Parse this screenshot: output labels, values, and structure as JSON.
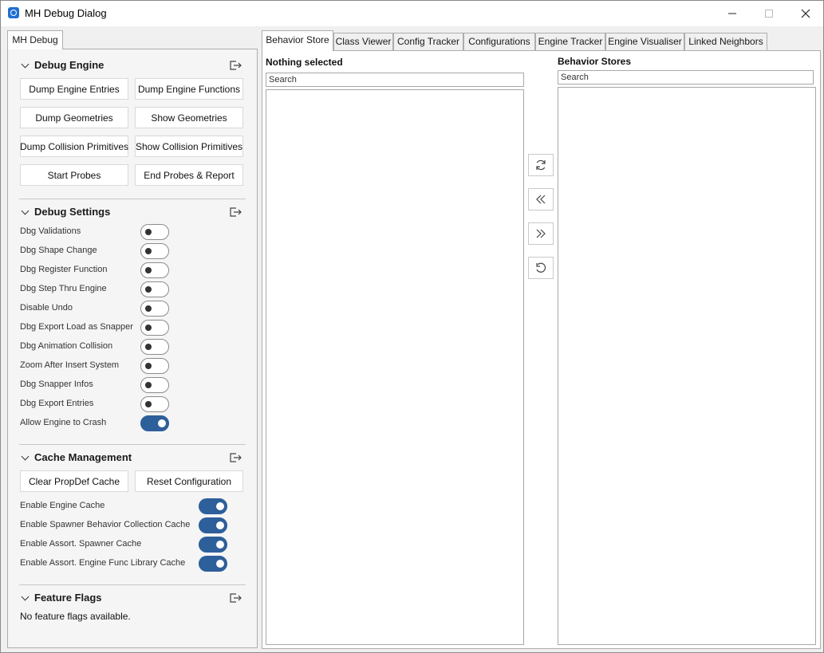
{
  "window": {
    "title": "MH Debug Dialog"
  },
  "left_tab": "MH Debug",
  "debug_engine": {
    "title": "Debug Engine",
    "buttons": [
      "Dump Engine Entries",
      "Dump Engine Functions",
      "Dump Geometries",
      "Show Geometries",
      "Dump Collision Primitives",
      "Show Collision Primitives",
      "Start Probes",
      "End Probes & Report"
    ]
  },
  "debug_settings": {
    "title": "Debug Settings",
    "toggles": [
      {
        "label": "Dbg Validations",
        "on": false
      },
      {
        "label": "Dbg Shape Change",
        "on": false
      },
      {
        "label": "Dbg Register Function",
        "on": false
      },
      {
        "label": "Dbg Step Thru Engine",
        "on": false
      },
      {
        "label": "Disable Undo",
        "on": false
      },
      {
        "label": "Dbg Export Load as Snapper",
        "on": false
      },
      {
        "label": "Dbg Animation Collision",
        "on": false
      },
      {
        "label": "Zoom After Insert System",
        "on": false
      },
      {
        "label": "Dbg Snapper Infos",
        "on": false
      },
      {
        "label": "Dbg Export Entries",
        "on": false
      },
      {
        "label": "Allow Engine to Crash",
        "on": true
      }
    ]
  },
  "cache_management": {
    "title": "Cache Management",
    "buttons": [
      "Clear PropDef Cache",
      "Reset Configuration"
    ],
    "toggles": [
      {
        "label": "Enable Engine Cache",
        "on": true
      },
      {
        "label": "Enable Spawner Behavior Collection Cache",
        "on": true
      },
      {
        "label": "Enable Assort. Spawner Cache",
        "on": true
      },
      {
        "label": "Enable Assort. Engine Func Library Cache",
        "on": true
      }
    ]
  },
  "feature_flags": {
    "title": "Feature Flags",
    "empty_text": "No feature flags available."
  },
  "tabs": [
    {
      "label": "Behavior Store",
      "active": true
    },
    {
      "label": "Class Viewer",
      "active": false
    },
    {
      "label": "Config Tracker",
      "active": false
    },
    {
      "label": "Configurations",
      "active": false
    },
    {
      "label": "Engine Tracker",
      "active": false
    },
    {
      "label": "Engine Visualiser",
      "active": false
    },
    {
      "label": "Linked Neighbors",
      "active": false
    }
  ],
  "behavior_store": {
    "left_title": "Nothing selected",
    "left_search_placeholder": "Search",
    "right_title": "Behavior Stores",
    "right_search_placeholder": "Search",
    "side_buttons": [
      "refresh-icon",
      "double-chevron-left-icon",
      "double-chevron-right-icon",
      "undo-icon"
    ]
  },
  "colors": {
    "toggle_on": "#2d5f9a",
    "accent": "#1f6fd1"
  }
}
